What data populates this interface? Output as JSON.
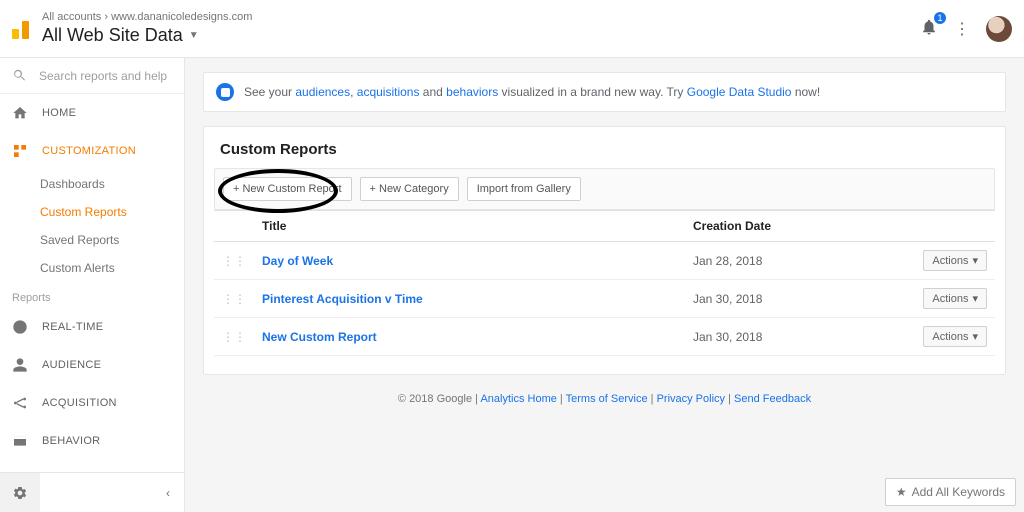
{
  "header": {
    "breadcrumb_accounts": "All accounts",
    "breadcrumb_site": "www.dananicoledesigns.com",
    "view_title": "All Web Site Data",
    "notif_count": "1"
  },
  "sidebar": {
    "search_placeholder": "Search reports and help",
    "home": "HOME",
    "customization": "CUSTOMIZATION",
    "subs": [
      "Dashboards",
      "Custom Reports",
      "Saved Reports",
      "Custom Alerts"
    ],
    "reports_label": "Reports",
    "realtime": "REAL-TIME",
    "audience": "AUDIENCE",
    "acquisition": "ACQUISITION",
    "behavior": "BEHAVIOR"
  },
  "banner": {
    "t1": "See your ",
    "a1": "audiences",
    "t2": ", ",
    "a2": "acquisitions",
    "t3": " and ",
    "a3": "behaviors",
    "t4": " visualized in a brand new way. Try ",
    "a4": "Google Data Studio",
    "t5": " now!"
  },
  "card": {
    "title": "Custom Reports",
    "btn_new": "+ New Custom Report",
    "btn_cat": "+ New Category",
    "btn_import": "Import from Gallery",
    "col_title": "Title",
    "col_date": "Creation Date",
    "actions_label": "Actions",
    "rows": [
      {
        "title": "Day of Week",
        "date": "Jan 28, 2018"
      },
      {
        "title": "Pinterest Acquisition v Time",
        "date": "Jan 30, 2018"
      },
      {
        "title": "New Custom Report",
        "date": "Jan 30, 2018"
      }
    ]
  },
  "footer": {
    "copyright": "© 2018 Google",
    "l1": "Analytics Home",
    "l2": "Terms of Service",
    "l3": "Privacy Policy",
    "l4": "Send Feedback"
  },
  "addkw": "Add All Keywords"
}
